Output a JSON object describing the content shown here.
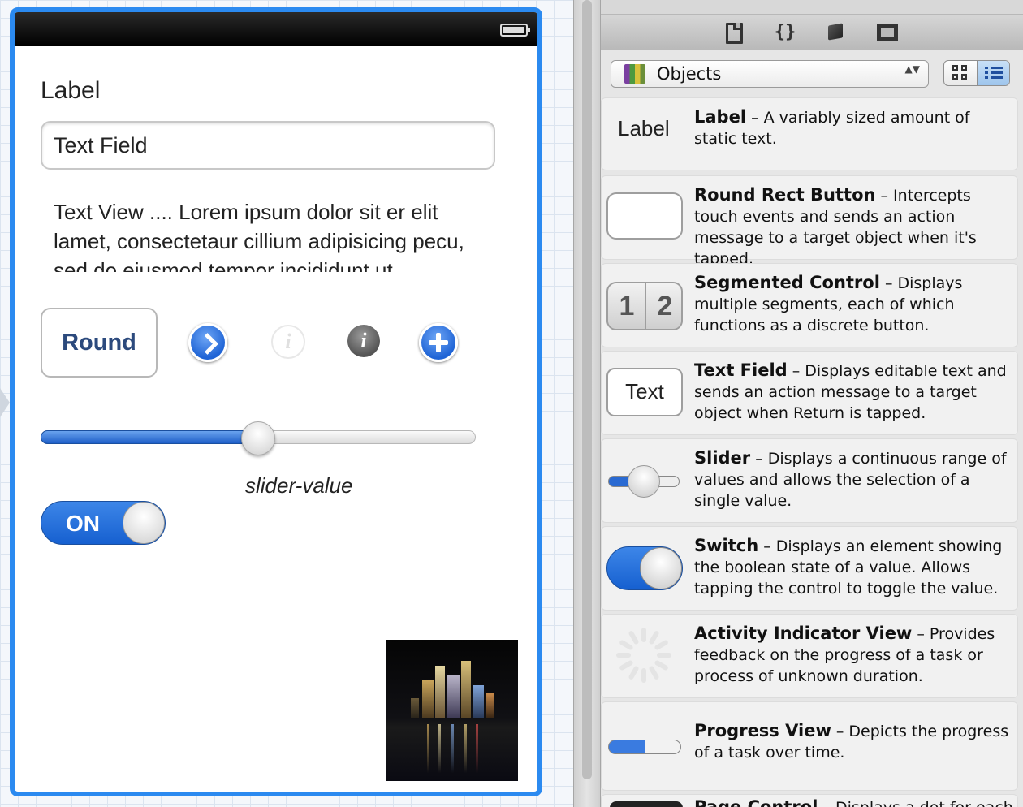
{
  "canvas": {
    "label_text": "Label",
    "text_field_value": "Text Field",
    "text_view_text": "Text View .... Lorem ipsum dolor sit er elit lamet, consectetaur cillium adipisicing pecu, sed do eiusmod tempor incididunt ut",
    "round_button_label": "Round",
    "info_light_glyph": "i",
    "info_dark_glyph": "i",
    "slider_value": 0.5,
    "slider_value_label": "slider-value",
    "switch_label": "ON",
    "switch_on": true
  },
  "library": {
    "tabs": [
      "file-template-library",
      "code-snippet-library",
      "object-library",
      "media-library"
    ],
    "code_snippet_glyph": "{}",
    "selector_label": "Objects",
    "selector_arrows": "▲▼",
    "selected_view_mode": "list",
    "items": [
      {
        "name": "Label",
        "desc": " – A variably sized amount of static text.",
        "icon_text": "Label"
      },
      {
        "name": "Round Rect Button",
        "desc": " – Intercepts touch events and sends an action message to a target object when it's tapped."
      },
      {
        "name": "Segmented Control",
        "desc": " – Displays multiple segments, each of which functions as a discrete button.",
        "icon_seg1": "1",
        "icon_seg2": "2"
      },
      {
        "name": "Text Field",
        "desc": " – Displays editable text and sends an action message to a target object when Return is tapped.",
        "icon_text": "Text"
      },
      {
        "name": "Slider",
        "desc": " – Displays a continuous range of values and allows the selection of a single value."
      },
      {
        "name": "Switch",
        "desc": " – Displays an element showing the boolean state of a value. Allows tapping the control to toggle the value."
      },
      {
        "name": "Activity Indicator View",
        "desc": " – Provides feedback on the progress of a task or process of unknown duration."
      },
      {
        "name": "Progress View",
        "desc": " – Depicts the progress of a task over time."
      },
      {
        "name": "Page Control",
        "desc": " – Displays a dot for each"
      }
    ]
  },
  "colors": {
    "selection_blue": "#2b8af0",
    "control_blue": "#1f64d6",
    "button_text": "#2c4a7d"
  }
}
